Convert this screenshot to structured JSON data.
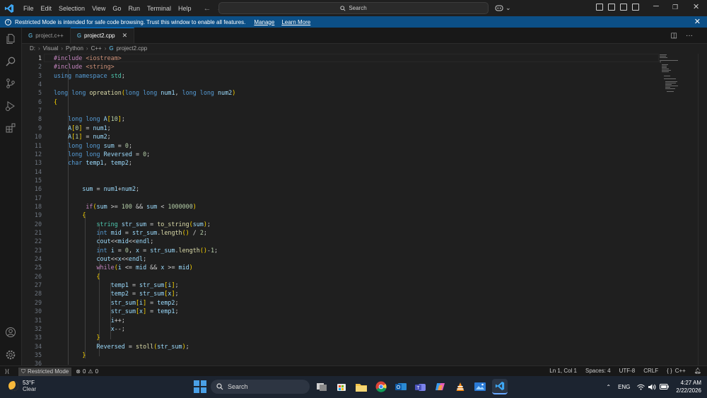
{
  "menu": [
    "File",
    "Edit",
    "Selection",
    "View",
    "Go",
    "Run",
    "Terminal",
    "Help"
  ],
  "search": {
    "placeholder": "Search"
  },
  "banner": {
    "message": "Restricted Mode is intended for safe code browsing. Trust this window to enable all features.",
    "manage": "Manage",
    "learn_more": "Learn More"
  },
  "tabs": [
    {
      "label": "project.c++",
      "active": false
    },
    {
      "label": "project2.cpp",
      "active": true
    }
  ],
  "breadcrumb": [
    "D:",
    "Visual",
    "Python",
    "C++",
    "project2.cpp"
  ],
  "code_lines": [
    "#include <iostream>",
    "#include <string>",
    "using namespace std;",
    "",
    "long long opreation(long long num1, long long num2)",
    "{",
    "",
    "    long long A[10];",
    "    A[0] = num1;",
    "    A[1] = num2;",
    "    long long sum = 0;",
    "    long long Reversed = 0;",
    "    char temp1, temp2;",
    "",
    "",
    "        sum = num1+num2;",
    "",
    "         if(sum >= 100 && sum < 1000000)",
    "        {",
    "            string str_sum = to_string(sum);",
    "            int mid = str_sum.length() / 2;",
    "            cout<<mid<<endl;",
    "            int i = 0, x = str_sum.length()-1;",
    "            cout<<x<<endl;",
    "            while(i <= mid && x >= mid)",
    "            {",
    "                temp1 = str_sum[i];",
    "                temp2 = str_sum[x];",
    "                str_sum[i] = temp2;",
    "                str_sum[x] = temp1;",
    "                i++;",
    "                x--;",
    "            }",
    "            Reversed = stoll(str_sum);",
    "        }",
    ""
  ],
  "status": {
    "restricted": "Restricted Mode",
    "errors": "0",
    "warnings": "0",
    "position": "Ln 1, Col 1",
    "spaces": "Spaces: 4",
    "encoding": "UTF-8",
    "eol": "CRLF",
    "language": "C++"
  },
  "taskbar": {
    "temp": "53°F",
    "weather": "Clear",
    "search": "Search",
    "lang": "ENG",
    "time": "4:27 AM",
    "date": "2/22/2026"
  }
}
